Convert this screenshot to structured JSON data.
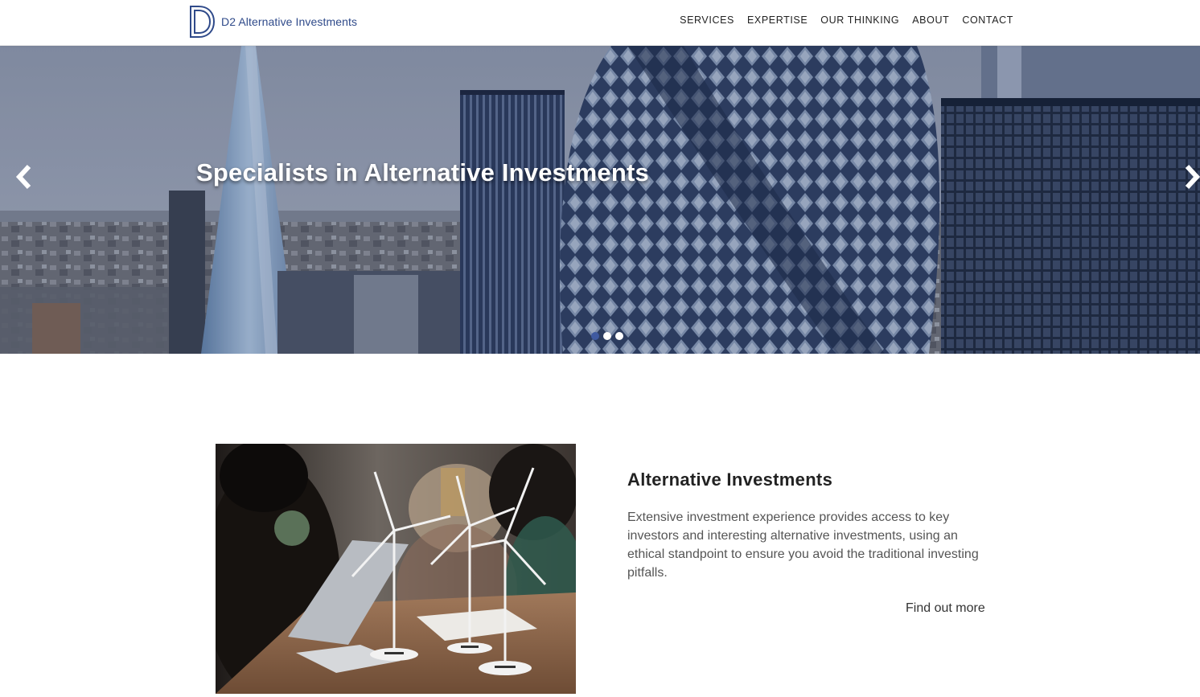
{
  "header": {
    "brand": "D2 Alternative Investments",
    "nav": [
      "SERVICES",
      "EXPERTISE",
      "OUR THINKING",
      "ABOUT",
      "CONTACT"
    ]
  },
  "hero": {
    "title": "Specialists in Alternative Investments",
    "slides_total": 3,
    "active_slide": 1
  },
  "feature": {
    "title": "Alternative Investments",
    "text": "Extensive investment experience provides access to key investors and interesting alternative investments, using an ethical standpoint to ensure you avoid the traditional investing pitfalls.",
    "link": "Find out more"
  },
  "colors": {
    "brand_blue": "#2f4a8a",
    "active_dot": "#3f5aa0"
  },
  "icons": [
    "d2-logo-icon",
    "chevron-left-icon",
    "chevron-right-icon"
  ]
}
